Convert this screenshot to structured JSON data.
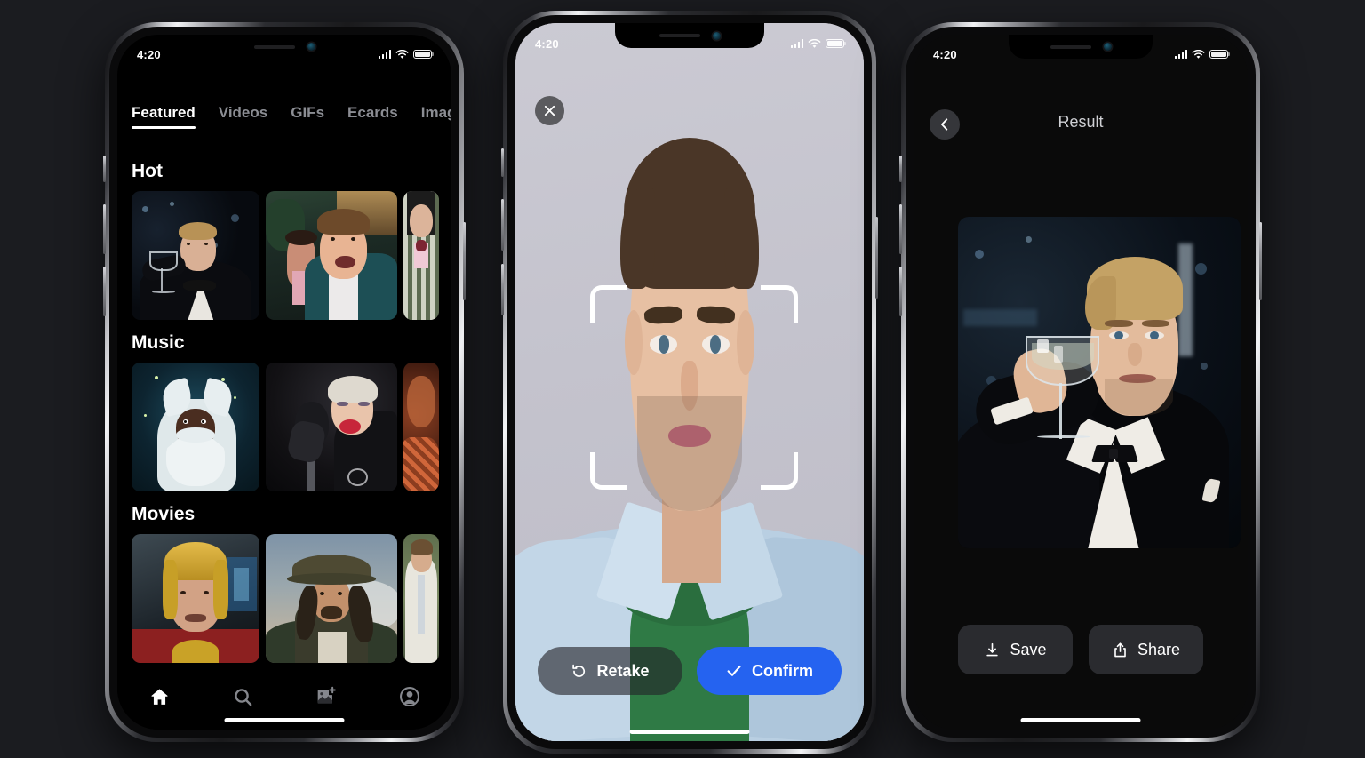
{
  "background_color": "#1b1c20",
  "accent_color": "#2563f0",
  "phone1": {
    "name": "featured-screen",
    "status": {
      "time": "4:20",
      "signal": "cellular-icon",
      "wifi": "wifi-icon",
      "battery": "battery-icon"
    },
    "tabs": [
      {
        "label": "Featured",
        "active": true
      },
      {
        "label": "Videos",
        "active": false
      },
      {
        "label": "GIFs",
        "active": false
      },
      {
        "label": "Ecards",
        "active": false
      },
      {
        "label": "Images",
        "active": false
      }
    ],
    "sections": [
      {
        "title": "Hot",
        "cards": [
          {
            "alt": "man-in-tuxedo-toasting-with-champagne-glass"
          },
          {
            "alt": "young-man-selfie-at-pool-party"
          },
          {
            "alt": "man-in-green-plaid-suit"
          }
        ]
      },
      {
        "title": "Music",
        "cards": [
          {
            "alt": "singer-in-white-fur-santa-costume-on-stage"
          },
          {
            "alt": "blonde-singer-at-microphone-in-black-dress"
          },
          {
            "alt": "warm-toned-concert-scene"
          }
        ]
      },
      {
        "title": "Movies",
        "cards": [
          {
            "alt": "man-in-gold-red-armor-helmet"
          },
          {
            "alt": "pirate-captain-with-tricorn-hat"
          },
          {
            "alt": "man-in-white-suit-on-bench"
          }
        ]
      }
    ],
    "tabbar": [
      {
        "icon": "home-icon",
        "label": "Home",
        "active": true
      },
      {
        "icon": "search-icon",
        "label": "Search",
        "active": false
      },
      {
        "icon": "add-photo-icon",
        "label": "Create",
        "active": false
      },
      {
        "icon": "profile-icon",
        "label": "Profile",
        "active": false
      }
    ]
  },
  "phone2": {
    "name": "capture-confirm-screen",
    "status": {
      "time": "4:20",
      "signal": "cellular-icon",
      "wifi": "wifi-icon",
      "battery": "battery-icon"
    },
    "close_icon": "close-icon",
    "face_frame": "face-detection-frame",
    "photo_alt": "portrait-of-man-in-light-blue-shirt-over-green-tee",
    "buttons": [
      {
        "label": "Retake",
        "icon": "rotate-left-icon",
        "style": "secondary"
      },
      {
        "label": "Confirm",
        "icon": "check-icon",
        "style": "primary"
      }
    ]
  },
  "phone3": {
    "name": "result-screen",
    "status": {
      "time": "4:20",
      "signal": "cellular-icon",
      "wifi": "wifi-icon",
      "battery": "battery-icon"
    },
    "back_icon": "chevron-left-icon",
    "title": "Result",
    "result_alt": "face-swapped-man-in-tuxedo-toasting-with-champagne-glass",
    "buttons": [
      {
        "label": "Save",
        "icon": "download-icon"
      },
      {
        "label": "Share",
        "icon": "share-icon"
      }
    ]
  }
}
